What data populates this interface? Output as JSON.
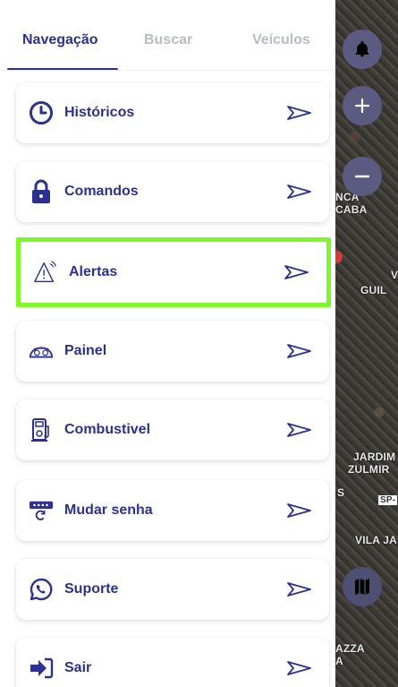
{
  "tabs": [
    {
      "label": "Navegação",
      "active": true
    },
    {
      "label": "Buscar",
      "active": false
    },
    {
      "label": "Veículos",
      "active": false
    }
  ],
  "menu": [
    {
      "label": "Históricos",
      "icon": "clock-icon"
    },
    {
      "label": "Comandos",
      "icon": "lock-icon"
    },
    {
      "label": "Alertas",
      "icon": "alert-icon",
      "highlighted": true
    },
    {
      "label": "Painel",
      "icon": "dashboard-icon"
    },
    {
      "label": "Combustivel",
      "icon": "fuel-pump-icon"
    },
    {
      "label": "Mudar senha",
      "icon": "password-reset-icon"
    },
    {
      "label": "Suporte",
      "icon": "whatsapp-icon"
    },
    {
      "label": "Sair",
      "icon": "logout-icon"
    }
  ],
  "map": {
    "labels": [
      "NCA",
      "CABA",
      "V",
      "GUIL",
      "JARDIM",
      "ZULMIR",
      "S",
      "SP-",
      "VILA JA",
      "AZZA",
      "A"
    ]
  },
  "colors": {
    "primary": "#2c3190",
    "highlight": "#7ff72a",
    "inactive_tab": "#b9bcc4",
    "map_button": "#5b5a80"
  }
}
